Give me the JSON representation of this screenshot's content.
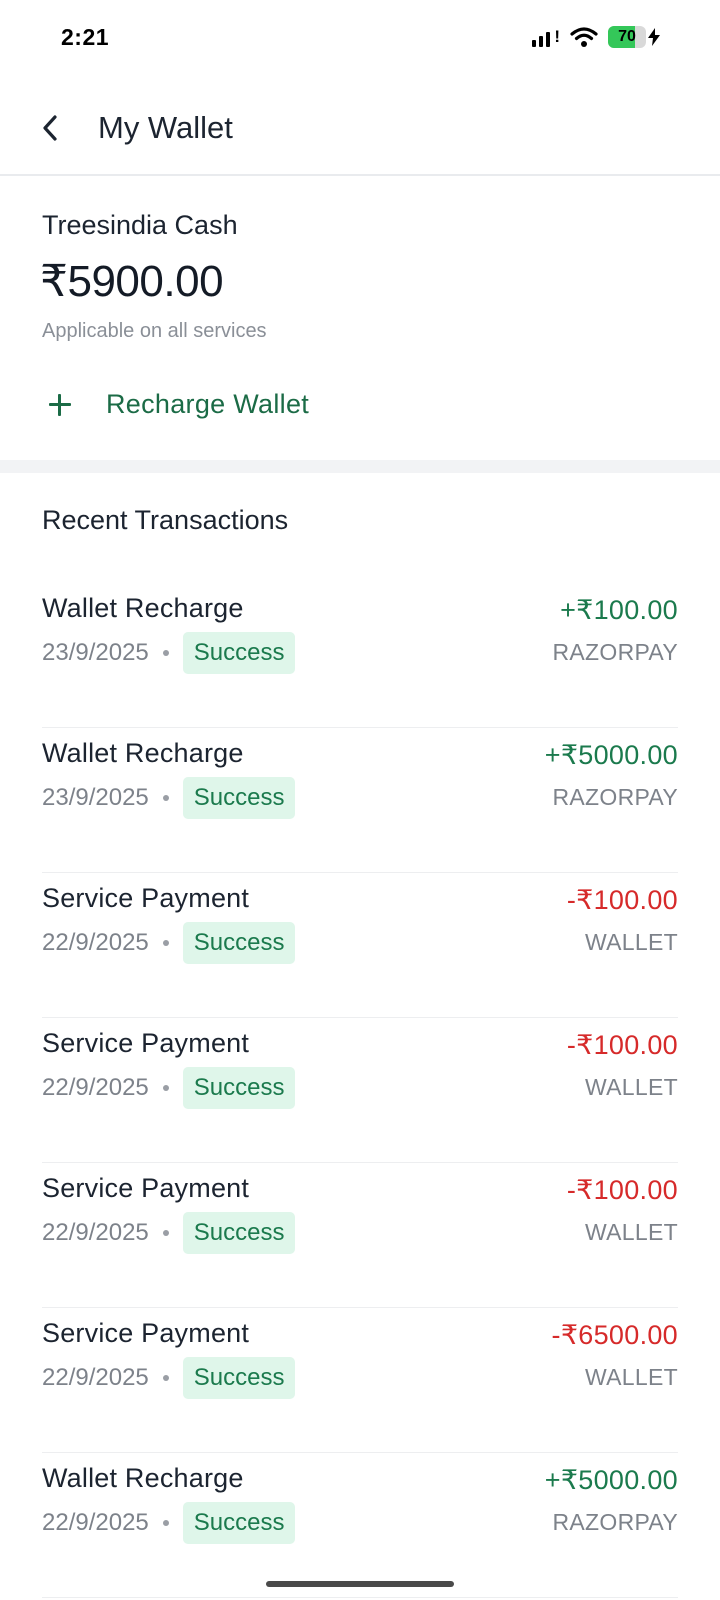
{
  "status_bar": {
    "time": "2:21",
    "battery": "70",
    "battery_level_percent": 70,
    "signal_icon": "cellular-signal-icon",
    "wifi_icon": "wifi-icon",
    "charging_icon": "bolt-icon"
  },
  "header": {
    "title": "My Wallet",
    "back_icon": "chevron-left-icon"
  },
  "wallet": {
    "cash_label": "Treesindia Cash",
    "balance": "₹5900.00",
    "applicable_text": "Applicable on all services",
    "recharge_label": "Recharge Wallet",
    "recharge_icon": "plus-icon"
  },
  "transactions": {
    "heading": "Recent Transactions",
    "items": [
      {
        "title": "Wallet Recharge",
        "date": "23/9/2025",
        "status": "Success",
        "amount": "+₹100.00",
        "type": "credit",
        "method": "RAZORPAY"
      },
      {
        "title": "Wallet Recharge",
        "date": "23/9/2025",
        "status": "Success",
        "amount": "+₹5000.00",
        "type": "credit",
        "method": "RAZORPAY"
      },
      {
        "title": "Service Payment",
        "date": "22/9/2025",
        "status": "Success",
        "amount": "-₹100.00",
        "type": "debit",
        "method": "WALLET"
      },
      {
        "title": "Service Payment",
        "date": "22/9/2025",
        "status": "Success",
        "amount": "-₹100.00",
        "type": "debit",
        "method": "WALLET"
      },
      {
        "title": "Service Payment",
        "date": "22/9/2025",
        "status": "Success",
        "amount": "-₹100.00",
        "type": "debit",
        "method": "WALLET"
      },
      {
        "title": "Service Payment",
        "date": "22/9/2025",
        "status": "Success",
        "amount": "-₹6500.00",
        "type": "debit",
        "method": "WALLET"
      },
      {
        "title": "Wallet Recharge",
        "date": "22/9/2025",
        "status": "Success",
        "amount": "+₹5000.00",
        "type": "credit",
        "method": "RAZORPAY"
      }
    ]
  },
  "colors": {
    "credit": "#1b7a4d",
    "debit": "#d62a2a",
    "accent": "#1b6b46",
    "badge_bg": "#dff6ea"
  }
}
